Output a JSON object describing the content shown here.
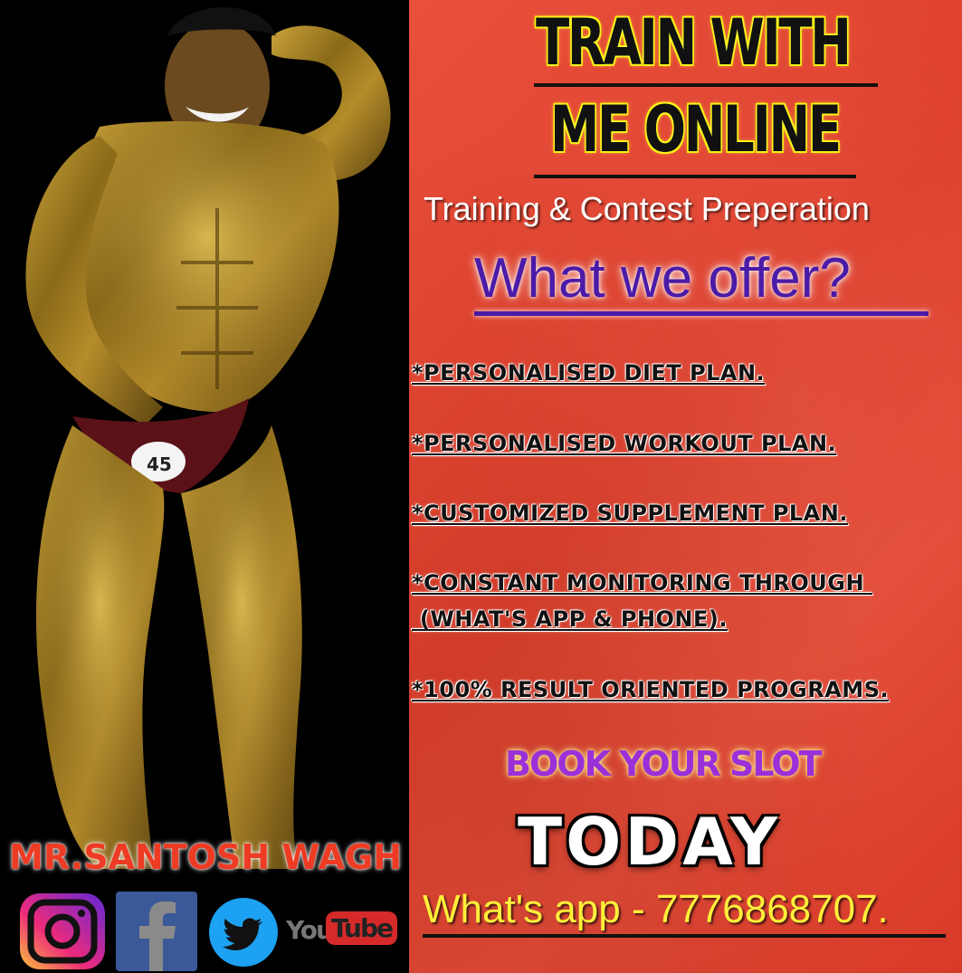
{
  "headline": {
    "line1": "TRAIN WITH",
    "line2": "ME ONLINE"
  },
  "subtitle": "Training & Contest Preperation",
  "offer_heading": "What we offer?",
  "features": [
    "*PERSONALISED DIET PLAN.",
    "*PERSONALISED WORKOUT PLAN.",
    "*CUSTOMIZED SUPPLEMENT PLAN.",
    "*CONSTANT MONITORING THROUGH ",
    " (WHAT'S APP & PHONE).",
    "*100% RESULT ORIENTED PROGRAMS."
  ],
  "cta": {
    "book": "BOOK YOUR SLOT",
    "today": "TODAY",
    "contact": "What's app - 7776868707."
  },
  "trainer_name": "MR.SANTOSH WAGH",
  "socials": {
    "icons": [
      "instagram-icon",
      "facebook-icon",
      "twitter-icon",
      "youtube-icon"
    ],
    "youtube_text_a": "You",
    "youtube_text_b": "Tube"
  },
  "colors": {
    "red_panel": "#de3f2c",
    "headline_glow": "#ffec00",
    "offer_purple": "#4b1ba8",
    "book_purple": "#9b30d9",
    "contact_yellow": "#ffef3a",
    "name_red": "#ee3b24"
  }
}
